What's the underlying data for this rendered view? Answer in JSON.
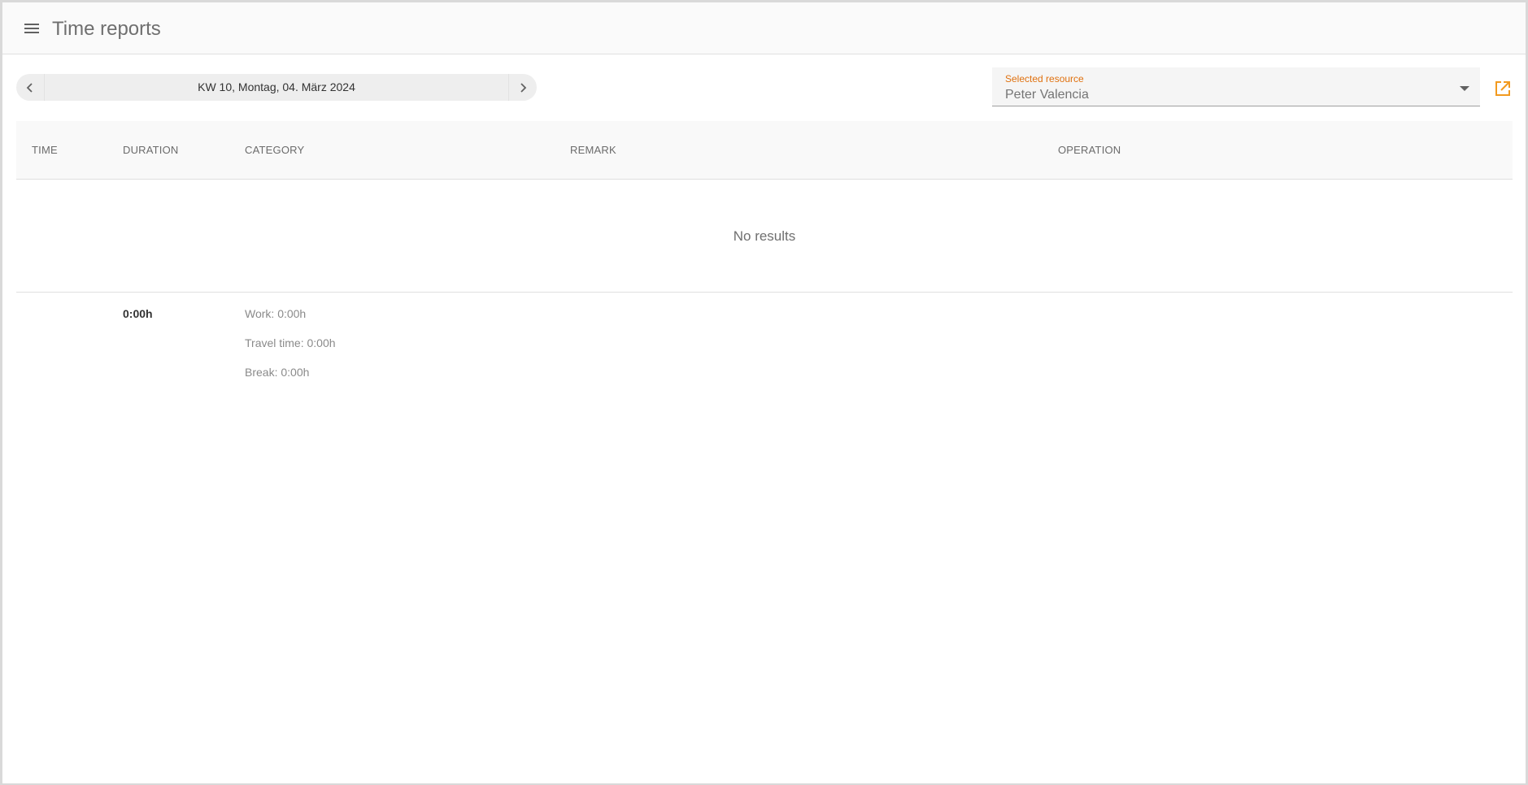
{
  "header": {
    "title": "Time reports",
    "menu_icon": "hamburger-menu-icon"
  },
  "date_nav": {
    "label": "KW 10, Montag, 04. März 2024",
    "prev_icon": "chevron-left-icon",
    "next_icon": "chevron-right-icon"
  },
  "resource": {
    "label": "Selected resource",
    "value": "Peter Valencia",
    "dropdown_icon": "caret-down-icon",
    "open_icon": "open-in-new-icon"
  },
  "table": {
    "columns": [
      "TIME",
      "DURATION",
      "CATEGORY",
      "REMARK",
      "OPERATION"
    ],
    "empty_text": "No results"
  },
  "summary": {
    "total_duration": "0:00h",
    "lines": [
      "Work: 0:00h",
      "Travel time: 0:00h",
      "Break: 0:00h"
    ]
  },
  "colors": {
    "accent": "#e0710f",
    "accent_icon": "#f29a1f"
  }
}
